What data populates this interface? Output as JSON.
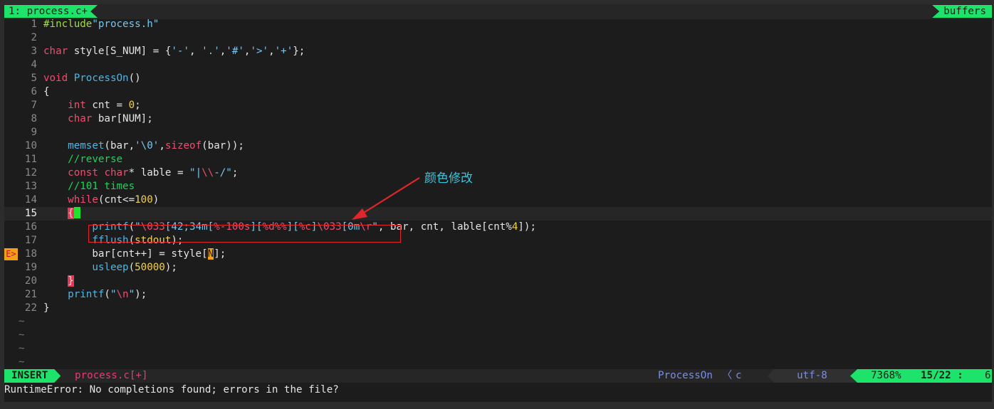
{
  "tabline": {
    "tab": "1: process.c+",
    "buffers": "buffers"
  },
  "code": {
    "l1": "1",
    "l2": "2",
    "l3": "3",
    "l4": "4",
    "l5": "5",
    "l6": "6",
    "l7": "7",
    "l8": "8",
    "l9": "9",
    "l10": "10",
    "l11": "11",
    "l12": "12",
    "l13": "13",
    "l14": "14",
    "l15": "15",
    "l16": "16",
    "l17": "17",
    "l18": "18",
    "l19": "19",
    "l20": "20",
    "l21": "21",
    "l22": "22",
    "tilde": "~",
    "sign": "E>",
    "include_kw": "#include",
    "include_file": "\"process.h\"",
    "char_kw": "char",
    "style_decl": " style[S_NUM] = {",
    "style_vals": [
      "'-'",
      "'.'",
      "'#'",
      "'>'",
      "'+'"
    ],
    "style_end": "};",
    "void_kw": "void",
    "func_name": "ProcessOn",
    "func_parens": "()",
    "open_brace": "{",
    "close_brace": "}",
    "int_kw": "int",
    "cnt_decl": " cnt = ",
    "zero": "0",
    "semi": ";",
    "bar_decl": " bar[NUM];",
    "memset": "memset",
    "memset_args1": "(bar,",
    "nul": "'\\0'",
    "comma": ",",
    "sizeof": "sizeof",
    "memset_args2": "(bar));",
    "comment_reverse": "//reverse",
    "const_kw": "const",
    "lable_decl": "* lable = ",
    "lable_str1": "\"|",
    "lable_esc": "\\\\",
    "lable_str2": "-/\"",
    "comment_times": "//101 times",
    "while_kw": "while",
    "while_cond1": "(cnt<=",
    "hundred": "100",
    "while_cond2": ")",
    "printf": "printf",
    "paren_open": "(",
    "pf_q1": "\"",
    "pf_e1": "\\033",
    "pf_s1": "[42;34m[",
    "pf_f1": "%-100s",
    "pf_s2": "][",
    "pf_f2": "%d",
    "pf_f3": "%%",
    "pf_s3": "][",
    "pf_f4": "%c",
    "pf_s4": "]",
    "pf_e2": "\\033",
    "pf_s5": "[0m",
    "pf_e3": "\\r",
    "pf_q2": "\"",
    "pf_args1": ", bar, cnt, lable[cnt%",
    "four": "4",
    "pf_args2": "]);",
    "fflush": "fflush",
    "stdout": "stdout",
    "fflush_end": ");",
    "bar_assign": "bar[cnt++] = style[",
    "n_char": "N",
    "bar_assign_end": "];",
    "usleep": "usleep",
    "fifty_k": "50000",
    "usleep_end": ");",
    "nl_str1": "\"",
    "nl_esc": "\\n",
    "nl_str2": "\"",
    "printf_end": ");"
  },
  "annotation": {
    "text": "颜色修改",
    "color": "#37c6e0",
    "box_color": "#e0262d"
  },
  "statusline": {
    "mode": "INSERT",
    "file": "process.c[+]",
    "function": "ProcessOn",
    "sep": "〈",
    "filetype": "c",
    "encoding": "utf-8",
    "percent": "7368%",
    "line_col": "15/22 :",
    "column": "6"
  },
  "cmdline": {
    "message": "RuntimeError: No completions found; errors in the file?"
  },
  "colors": {
    "accent": "#1ee36a",
    "keyword": "#ec4f6f",
    "function": "#4fb6e3",
    "string": "#76c7ef",
    "number": "#f2d14a",
    "comment": "#1fd35a"
  }
}
